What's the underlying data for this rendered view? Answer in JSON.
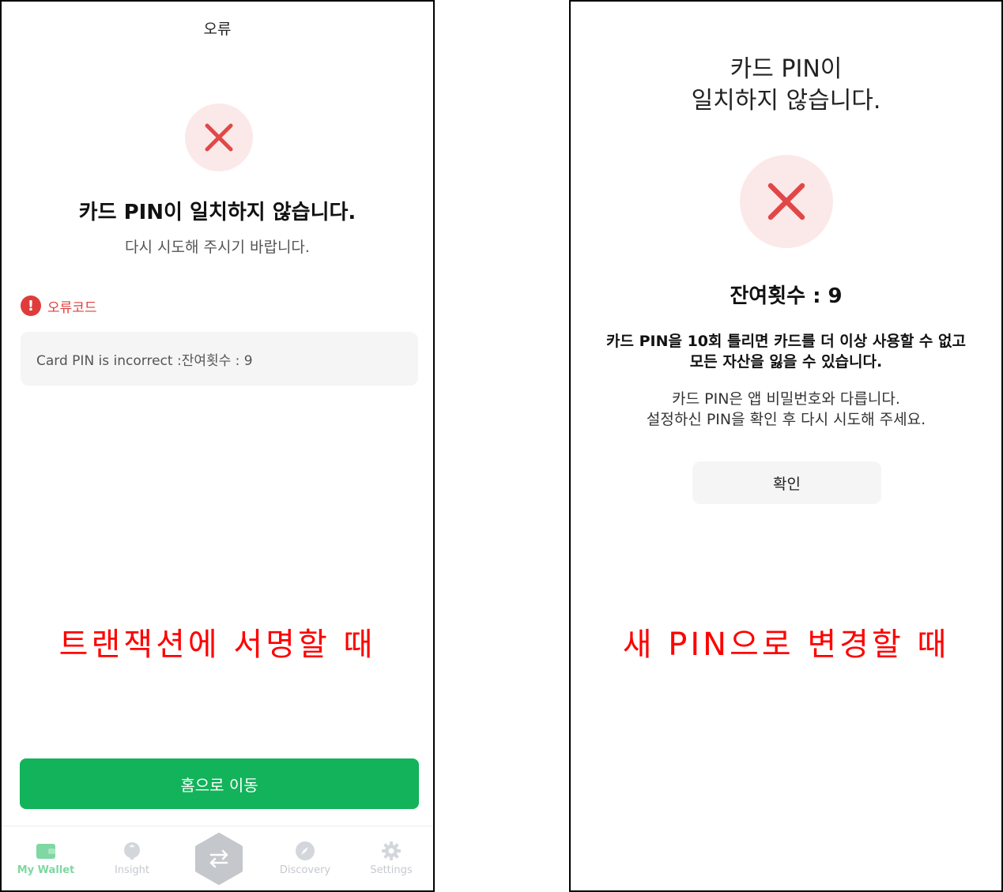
{
  "left": {
    "header_title": "오류",
    "message_title": "카드 PIN이 일치하지 않습니다.",
    "message_subtitle": "다시 시도해 주시기 바랍니다.",
    "error_code_label": "오류코드",
    "error_code_alert": "!",
    "error_detail": "Card PIN is incorrect :잔여횟수 : 9",
    "caption": "트랜잭션에 서명할 때",
    "home_button": "홈으로 이동",
    "tabs": [
      {
        "label": "My Wallet",
        "icon": "wallet-icon",
        "active": true
      },
      {
        "label": "Insight",
        "icon": "lightbulb-icon",
        "active": false
      },
      {
        "label": "",
        "icon": "swap-icon",
        "active": false
      },
      {
        "label": "Discovery",
        "icon": "compass-icon",
        "active": false
      },
      {
        "label": "Settings",
        "icon": "gear-icon",
        "active": false
      }
    ]
  },
  "right": {
    "title_line1": "카드 PIN이",
    "title_line2": "일치하지 않습니다.",
    "remaining": "잔여횟수 : 9",
    "warning_line1": "카드 PIN을 10회 틀리면 카드를 더 이상 사용할 수 없고",
    "warning_line2": "모든 자산을 잃을 수 있습니다.",
    "info_line1": "카드 PIN은 앱 비밀번호와 다릅니다.",
    "info_line2": "설정하신 PIN을 확인 후 다시 시도해 주세요.",
    "confirm_button": "확인",
    "caption": "새 PIN으로 변경할 때"
  },
  "colors": {
    "primary_green": "#12b35a",
    "error_red": "#e03b3b",
    "caption_red": "#ff0000",
    "error_circle_bg": "#fbe9e9"
  }
}
